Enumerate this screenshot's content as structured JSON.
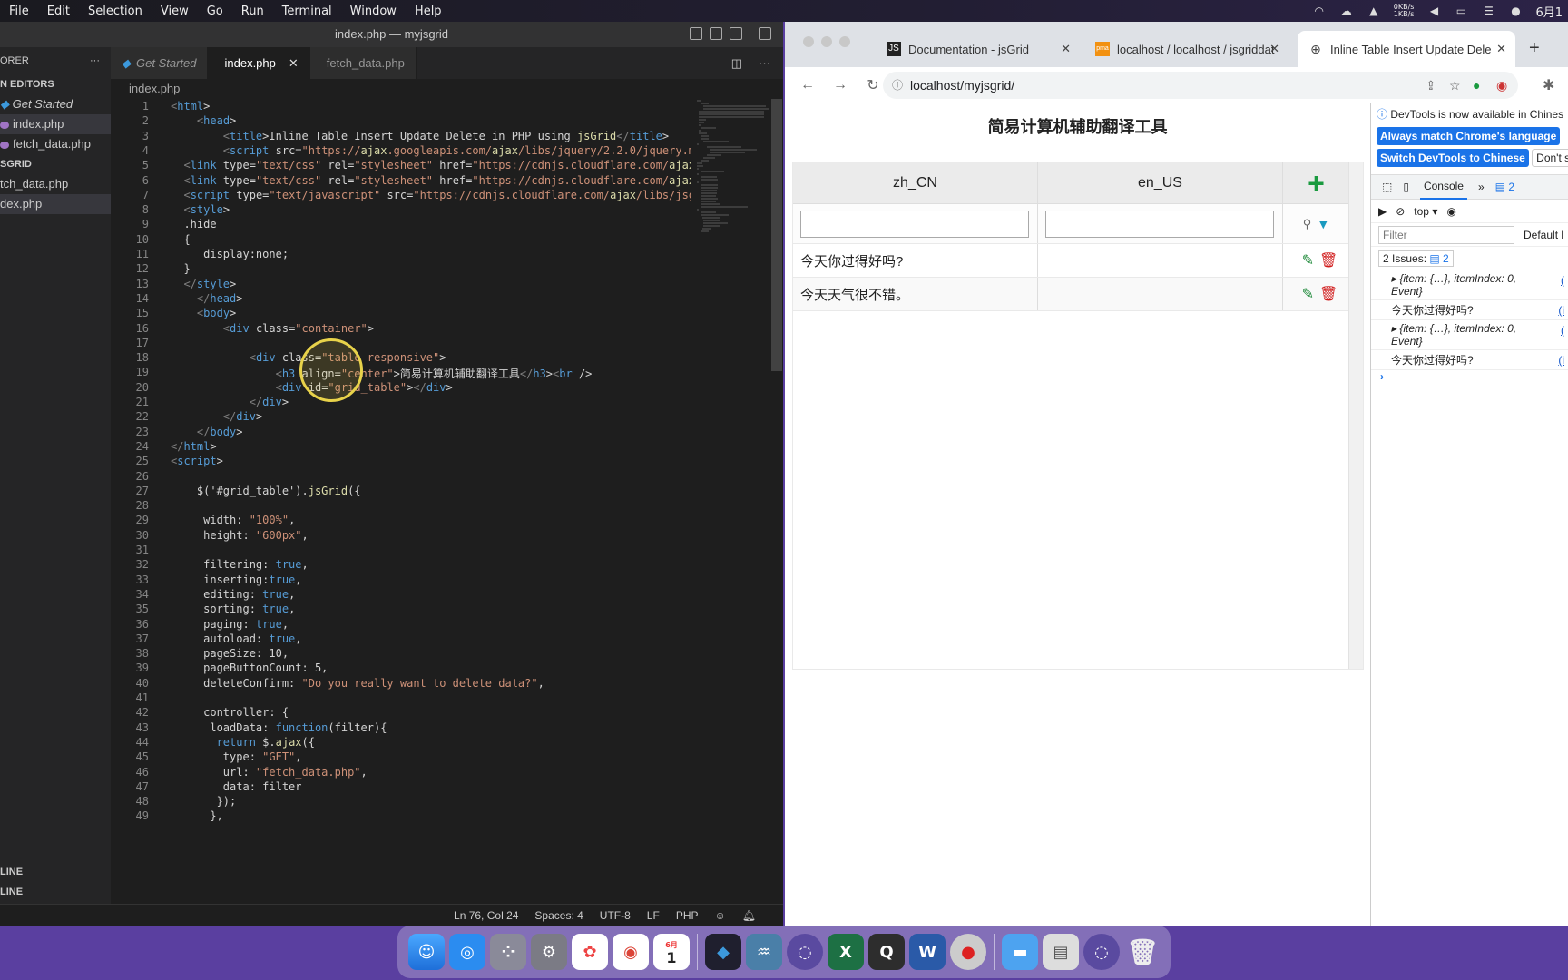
{
  "menubar": {
    "items": [
      "File",
      "Edit",
      "Selection",
      "View",
      "Go",
      "Run",
      "Terminal",
      "Window",
      "Help"
    ],
    "netspeed_up": "0KB/s",
    "netspeed_down": "1KB/s",
    "date": "6月1"
  },
  "vscode": {
    "title": "index.php — myjsgrid",
    "explorer_header": "ORER",
    "sidebar": {
      "open_editors": "N EDITORS",
      "open_items": [
        "Get Started",
        "index.php",
        "fetch_data.php"
      ],
      "folder": "SGRID",
      "folder_items": [
        "tch_data.php",
        "dex.php"
      ],
      "outline": "LINE",
      "timeline": "LINE"
    },
    "tabs": [
      {
        "label": "Get Started"
      },
      {
        "label": "index.php"
      },
      {
        "label": "fetch_data.php"
      }
    ],
    "breadcrumb": "index.php",
    "status": {
      "position": "Ln 76, Col 24",
      "spaces": "Spaces: 4",
      "encoding": "UTF-8",
      "eol": "LF",
      "lang": "PHP"
    },
    "lines": [
      "<html>",
      "    <head>",
      "        <title>Inline Table Insert Update Delete in PHP using jsGrid</title>",
      "        <script src=\"https://ajax.googleapis.com/ajax/libs/jquery/2.2.0/jquery.m",
      "  <link type=\"text/css\" rel=\"stylesheet\" href=\"https://cdnjs.cloudflare.com/ajax",
      "  <link type=\"text/css\" rel=\"stylesheet\" href=\"https://cdnjs.cloudflare.com/ajax",
      "  <script type=\"text/javascript\" src=\"https://cdnjs.cloudflare.com/ajax/libs/jsg",
      "  <style>",
      "  .hide",
      "  {",
      "     display:none;",
      "  }",
      "  </style>",
      "    </head>",
      "    <body>",
      "        <div class=\"container\">",
      "",
      "            <div class=\"table-responsive\">",
      "                <h3 align=\"center\">简易计算机辅助翻译工具</h3><br />",
      "                <div id=\"grid_table\"></div>",
      "            </div>",
      "        </div>",
      "    </body>",
      "</html>",
      "<script>",
      "",
      "    $('#grid_table').jsGrid({",
      "",
      "     width: \"100%\",",
      "     height: \"600px\",",
      "",
      "     filtering: true,",
      "     inserting:true,",
      "     editing: true,",
      "     sorting: true,",
      "     paging: true,",
      "     autoload: true,",
      "     pageSize: 10,",
      "     pageButtonCount: 5,",
      "     deleteConfirm: \"Do you really want to delete data?\",",
      "",
      "     controller: {",
      "      loadData: function(filter){",
      "       return $.ajax({",
      "        type: \"GET\",",
      "        url: \"fetch_data.php\",",
      "        data: filter",
      "       });",
      "      },"
    ]
  },
  "chrome": {
    "tabs": [
      {
        "label": "Documentation - jsGrid",
        "fav": "JS"
      },
      {
        "label": "localhost / localhost / jsgriddat",
        "fav": "pma"
      },
      {
        "label": "Inline Table Insert Update Dele",
        "fav": "⊕"
      }
    ],
    "url": "localhost/myjsgrid/",
    "page_title": "简易计算机辅助翻译工具",
    "grid": {
      "columns": [
        "zh_CN",
        "en_US"
      ],
      "rows": [
        {
          "zh": "今天你过得好吗?",
          "en": ""
        },
        {
          "zh": "今天天气很不错。",
          "en": ""
        }
      ]
    },
    "devtools": {
      "banner": "DevTools is now available in Chines",
      "btn_match": "Always match Chrome's language",
      "btn_switch": "Switch DevTools to Chinese",
      "btn_dont": "Don't s",
      "tab_console": "Console",
      "issues_badge": "2",
      "context": "top",
      "filter_placeholder": "Filter",
      "levels": "Default l",
      "issues": "2 Issues:",
      "issues_count": "2",
      "logs": [
        {
          "text": "{item: {…}, itemIndex: 0,",
          "text2": "Event}",
          "plain": false
        },
        {
          "text": "今天你过得好吗?",
          "text2": "",
          "plain": true
        },
        {
          "text": "{item: {…}, itemIndex: 0,",
          "text2": "Event}",
          "plain": false
        },
        {
          "text": "今天你过得好吗?",
          "text2": "",
          "plain": true
        }
      ]
    }
  },
  "dock": {
    "icons": [
      "finder",
      "safari",
      "launchpad",
      "system-settings",
      "photos",
      "chrome",
      "calendar",
      "vscode",
      "mysql-workbench",
      "obs",
      "excel",
      "quicktime",
      "word",
      "screen-recorder",
      "folder",
      "preview",
      "obs-2",
      "trash"
    ],
    "calendar_day": "1",
    "calendar_month": "6月"
  }
}
